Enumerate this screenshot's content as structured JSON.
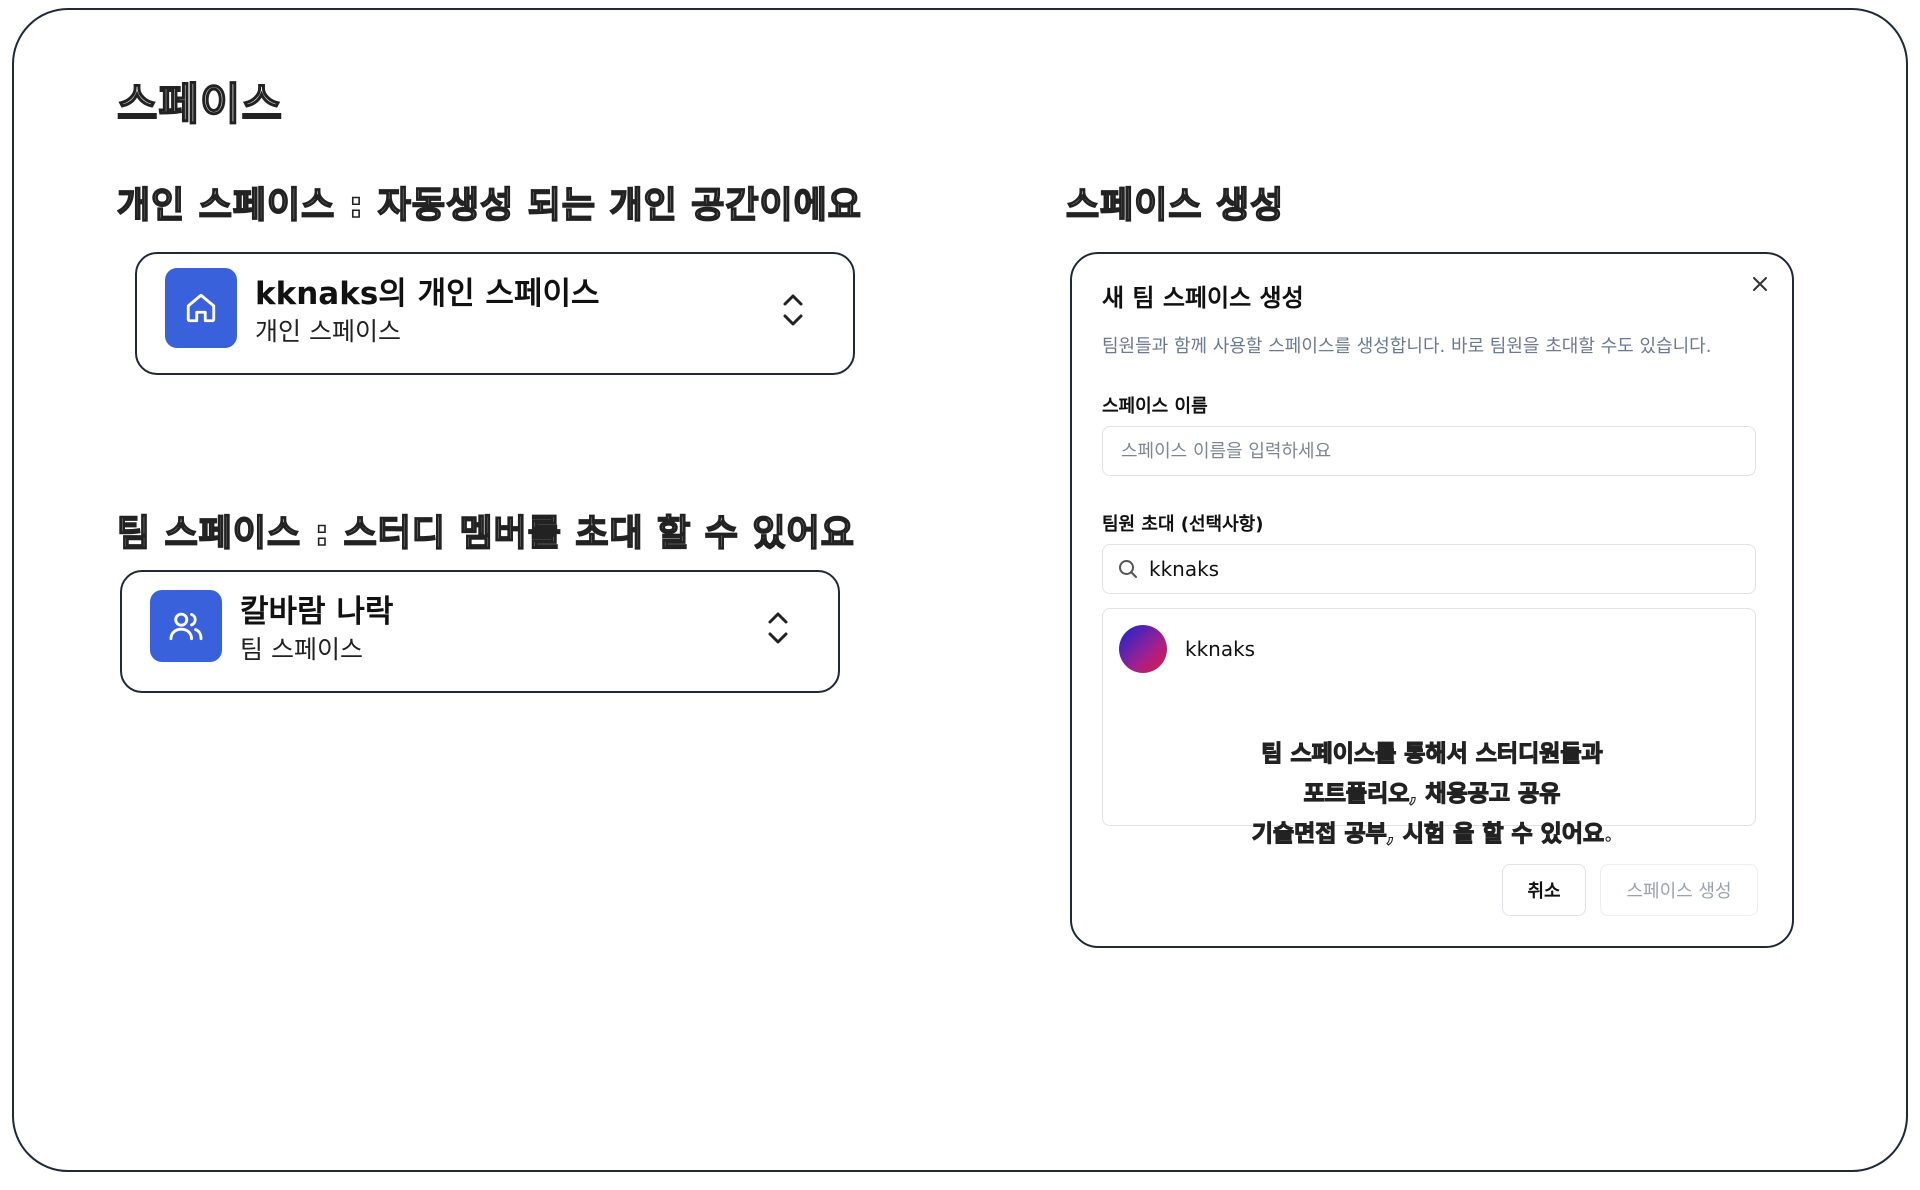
{
  "page": {
    "title": "스페이스"
  },
  "personal_section": {
    "heading": "개인 스페이스 : 자동생성 되는 개인 공간이에요",
    "space_name": "kknaks의 개인 스페이스",
    "space_type": "개인 스페이스",
    "icon": "home-icon"
  },
  "team_section": {
    "heading": "팀 스페이스 : 스터디 멤버를 초대 할 수 있어요",
    "space_name": "칼바람 나락",
    "space_type": "팀 스페이스",
    "icon": "users-icon"
  },
  "create_section": {
    "heading": "스페이스 생성"
  },
  "dialog": {
    "title": "새 팀 스페이스 생성",
    "description": "팀원들과 함께 사용할 스페이스를 생성합니다. 바로 팀원을 초대할 수도 있습니다.",
    "name_label": "스페이스 이름",
    "name_placeholder": "스페이스 이름을 입력하세요",
    "invite_label": "팀원 초대 (선택사항)",
    "search_value": "kknaks",
    "result_user": "kknaks",
    "cancel_label": "취소",
    "create_label": "스페이스 생성",
    "accent_color": "#3a61dc"
  },
  "annotation": {
    "line1": "팀 스페이스를 통해서 스터디원들과",
    "line2": "포트폴리오, 채용공고 공유",
    "line3": "기술면접 공부, 시험 을 할 수 있어요."
  }
}
